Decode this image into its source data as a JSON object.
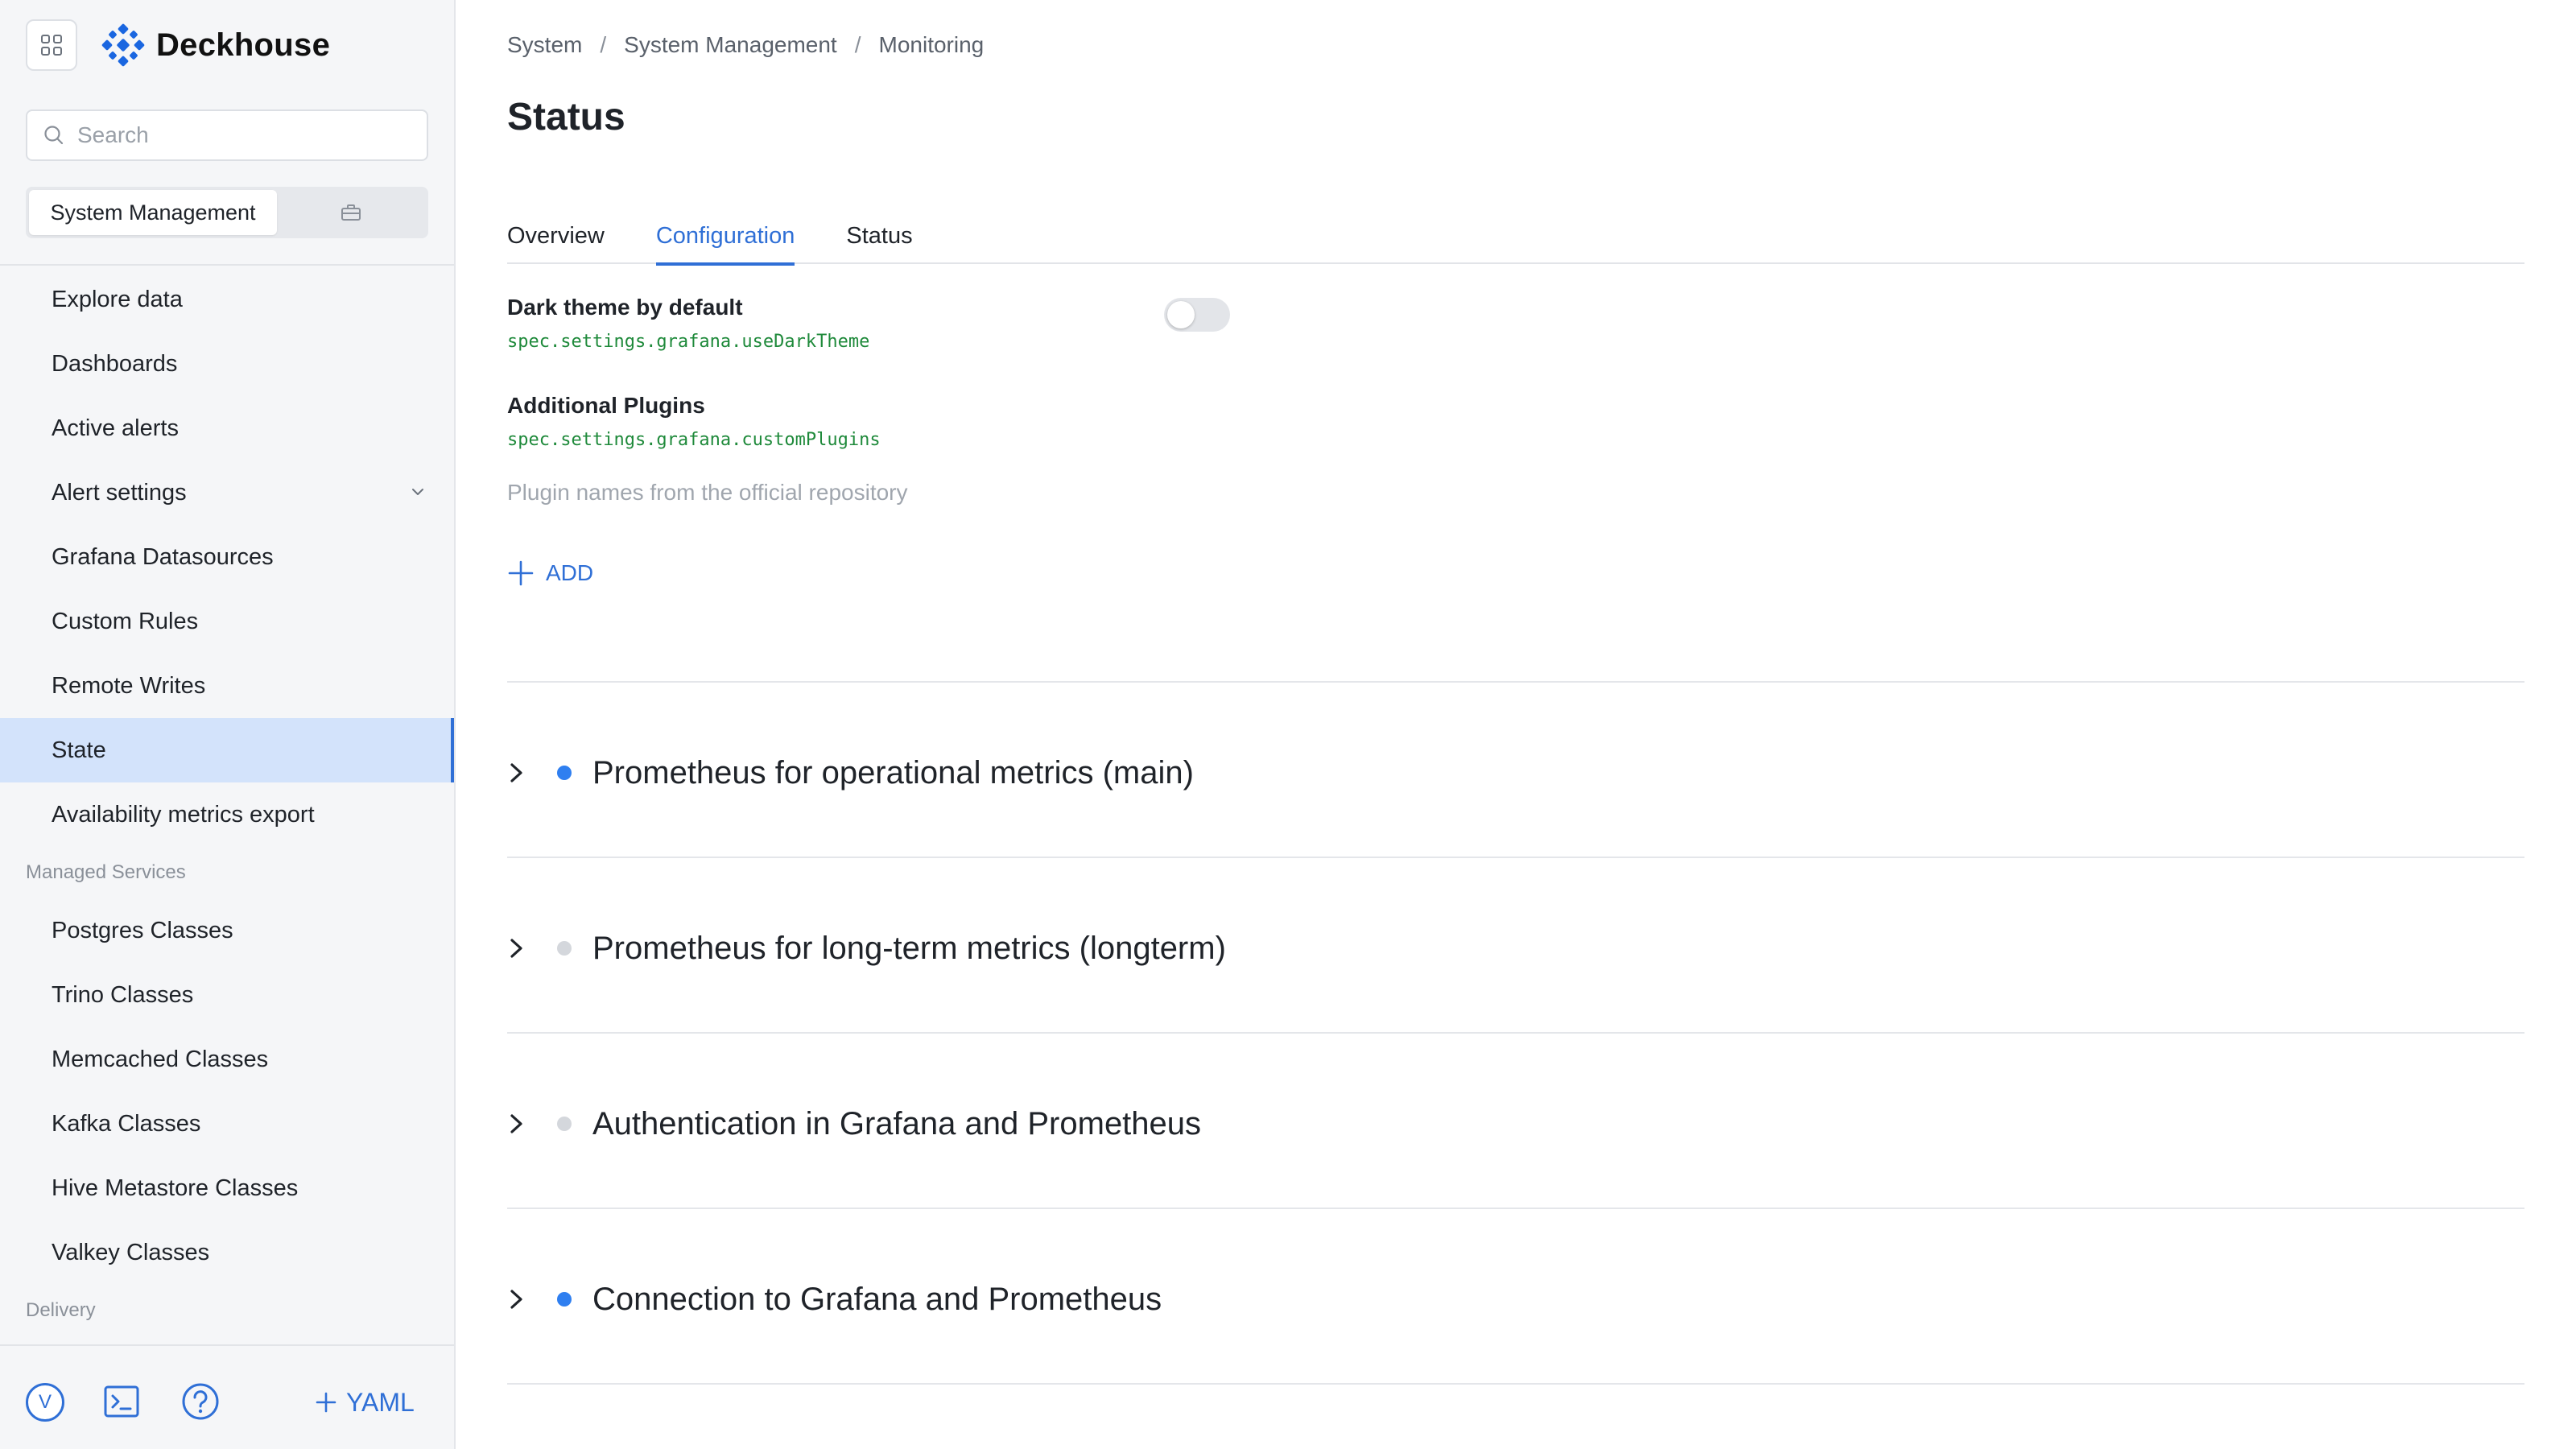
{
  "app": {
    "brand": "Deckhouse",
    "brand_color": "#1a66e0",
    "accent": "#2f6fd6",
    "search_placeholder": "Search",
    "context_active": "System Management",
    "context_other_icon": "briefcase-icon"
  },
  "sidebar": {
    "items": [
      {
        "label": "Explore data"
      },
      {
        "label": "Dashboards"
      },
      {
        "label": "Active alerts"
      },
      {
        "label": "Alert settings"
      },
      {
        "label": "Grafana Datasources"
      },
      {
        "label": "Custom Rules"
      },
      {
        "label": "Remote Writes"
      },
      {
        "label": "State"
      },
      {
        "label": "Availability metrics export"
      }
    ],
    "section_managed": "Managed Services",
    "managed_items": [
      {
        "label": "Postgres Classes"
      },
      {
        "label": "Trino Classes"
      },
      {
        "label": "Memcached Classes"
      },
      {
        "label": "Kafka Classes"
      },
      {
        "label": "Hive Metastore Classes"
      },
      {
        "label": "Valkey Classes"
      }
    ],
    "section_delivery": "Delivery",
    "user_initial": "V",
    "yaml_label": "YAML"
  },
  "breadcrumb": [
    "System",
    "System Management",
    "Monitoring"
  ],
  "breadcrumb_sep": "/",
  "page": {
    "title": "Status",
    "tabs": [
      "Overview",
      "Configuration",
      "Status"
    ],
    "active_tab": "Configuration"
  },
  "config": {
    "dark_theme_label": "Dark theme by default",
    "dark_theme_path": "spec.settings.grafana.useDarkTheme",
    "dark_theme_enabled": false,
    "plugins_label": "Additional Plugins",
    "plugins_path": "spec.settings.grafana.customPlugins",
    "plugins_hint": "Plugin names from the official repository",
    "add_label": "ADD"
  },
  "sections": [
    {
      "title": "Prometheus for operational metrics (main)",
      "status_color": "#2f7ff0"
    },
    {
      "title": "Prometheus for long-term metrics (longterm)",
      "status_color": "#d4d7dc"
    },
    {
      "title": "Authentication in Grafana and Prometheus",
      "status_color": "#d4d7dc"
    },
    {
      "title": "Connection to Grafana and Prometheus",
      "status_color": "#2f7ff0"
    }
  ]
}
